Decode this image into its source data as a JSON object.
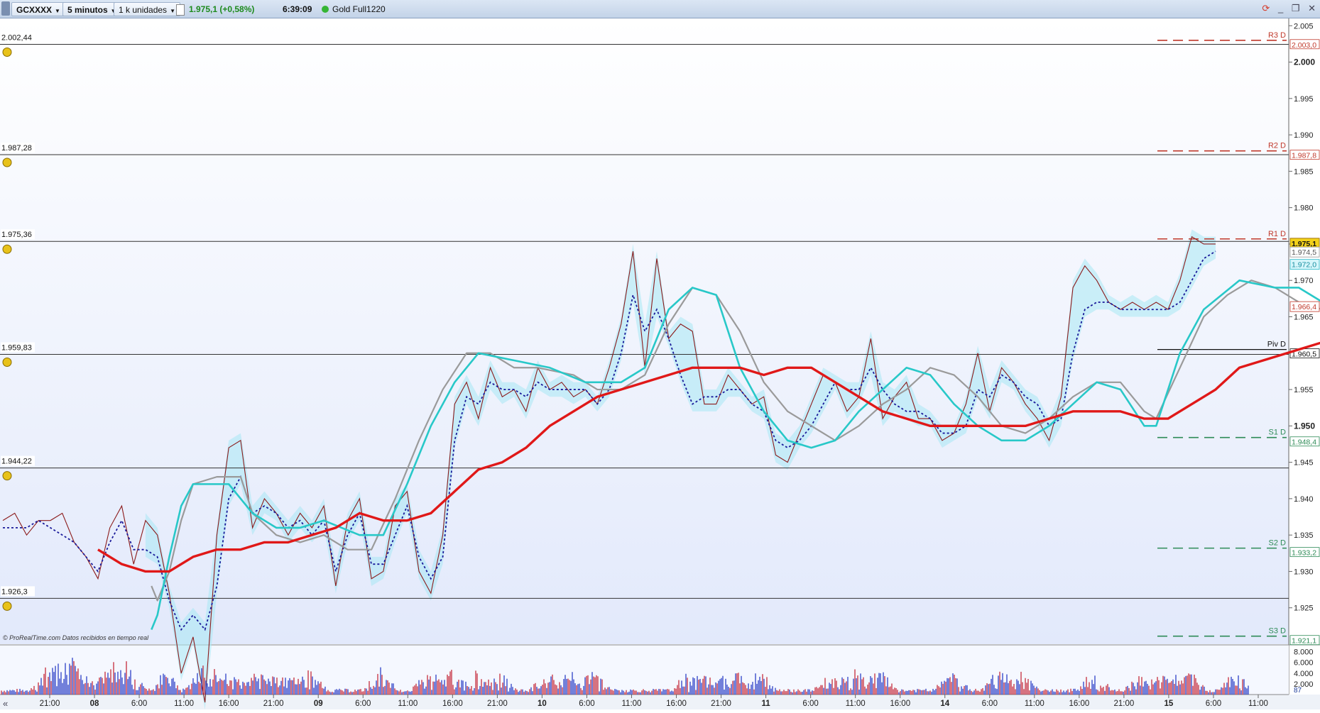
{
  "toolbar": {
    "symbol": "GCXXXX",
    "timeframe": "5 minutos",
    "units": "1 k unidades",
    "price_change": "1.975,1 (+0,58%)",
    "time": "6:39:09",
    "instrument": "Gold Full1220"
  },
  "watermark": "© ProRealTime.com  Datos recibidos en tiempo real",
  "colors": {
    "price_line": "#8b1a1a",
    "ma_red": "#e01818",
    "ma_cyan": "#28c8c8",
    "ma_gray": "#9a9a9a",
    "ma_dotted": "#1a1a9a",
    "resistance": "#c0392b",
    "support": "#2e8b57",
    "cloud": "#a8e8f4"
  },
  "chart_data": {
    "type": "line",
    "title": "",
    "y_range": [
      1920,
      2006
    ],
    "y_ticks": [
      "2.005",
      "2.000",
      "1.995",
      "1.990",
      "1.985",
      "1.980",
      "1.975",
      "1.970",
      "1.965",
      "1.955",
      "1.950",
      "1.945",
      "1.940",
      "1.935",
      "1.930",
      "1.925"
    ],
    "x_ticks": [
      "21:00",
      "08",
      "6:00",
      "11:00",
      "16:00",
      "21:00",
      "09",
      "6:00",
      "11:00",
      "16:00",
      "21:00",
      "10",
      "6:00",
      "11:00",
      "16:00",
      "21:00",
      "11",
      "6:00",
      "11:00",
      "16:00",
      "14",
      "6:00",
      "11:00",
      "16:00",
      "21:00",
      "15",
      "6:00",
      "11:00"
    ],
    "horizontal_levels": [
      {
        "label": "2.002,44",
        "value": 2002.44
      },
      {
        "label": "1.987,28",
        "value": 1987.28
      },
      {
        "label": "1.975,36",
        "value": 1975.36
      },
      {
        "label": "1.959,83",
        "value": 1959.83
      },
      {
        "label": "1.944,22",
        "value": 1944.22
      },
      {
        "label": "1.926,3",
        "value": 1926.3
      }
    ],
    "pivot_levels": [
      {
        "name": "R3 D",
        "value": 2003.0,
        "tag": "2.003,0",
        "kind": "r"
      },
      {
        "name": "R2 D",
        "value": 1987.8,
        "tag": "1.987,8",
        "kind": "r"
      },
      {
        "name": "R1 D",
        "value": 1975.7,
        "tag": "1.975,7",
        "kind": "r"
      },
      {
        "name": "Piv D",
        "value": 1960.5,
        "tag": "1.960,5",
        "kind": "p"
      },
      {
        "name": "S1 D",
        "value": 1948.4,
        "tag": "1.948,4",
        "kind": "s"
      },
      {
        "name": "S2 D",
        "value": 1933.2,
        "tag": "1.933,2",
        "kind": "s"
      },
      {
        "name": "S3 D",
        "value": 1921.1,
        "tag": "1.921,1",
        "kind": "s"
      }
    ],
    "right_tags": [
      {
        "text": "1.975,1",
        "value": 1975.1,
        "kind": "current"
      },
      {
        "text": "1.974,5",
        "value": 1973.9,
        "kind": "plain"
      },
      {
        "text": "1.972,0",
        "value": 1972.2,
        "kind": "cyan"
      },
      {
        "text": "1.966,4",
        "value": 1966.4,
        "kind": "red"
      }
    ],
    "series": [
      {
        "name": "price",
        "values": [
          1937,
          1938,
          1935,
          1937,
          1937,
          1938,
          1934,
          1932,
          1929,
          1936,
          1939,
          1931,
          1937,
          1935,
          1927,
          1916,
          1921,
          1912,
          1935,
          1947,
          1948,
          1936,
          1940,
          1938,
          1935,
          1938,
          1936,
          1939,
          1928,
          1937,
          1940,
          1929,
          1930,
          1939,
          1941,
          1930,
          1927,
          1935,
          1953,
          1956,
          1951,
          1958,
          1954,
          1955,
          1952,
          1958,
          1955,
          1956,
          1954,
          1955,
          1953,
          1958,
          1964,
          1974,
          1958,
          1973,
          1962,
          1964,
          1963,
          1953,
          1953,
          1957,
          1955,
          1953,
          1954,
          1946,
          1945,
          1949,
          1953,
          1957,
          1956,
          1952,
          1954,
          1962,
          1951,
          1954,
          1956,
          1951,
          1951,
          1948,
          1949,
          1953,
          1960,
          1952,
          1958,
          1956,
          1953,
          1951,
          1948,
          1954,
          1969,
          1972,
          1970,
          1967,
          1966,
          1967,
          1966,
          1967,
          1966,
          1970,
          1976,
          1975,
          1975
        ]
      },
      {
        "name": "ma_dotted",
        "values": [
          1936,
          1936,
          1936,
          1937,
          1936,
          1935,
          1934,
          1932,
          1930,
          1934,
          1937,
          1933,
          1933,
          1932,
          1926,
          1922,
          1924,
          1922,
          1928,
          1940,
          1943,
          1938,
          1939,
          1938,
          1936,
          1937,
          1935,
          1937,
          1930,
          1935,
          1938,
          1931,
          1931,
          1935,
          1939,
          1932,
          1929,
          1932,
          1948,
          1954,
          1953,
          1956,
          1955,
          1955,
          1954,
          1956,
          1955,
          1955,
          1955,
          1955,
          1953,
          1955,
          1960,
          1968,
          1963,
          1966,
          1962,
          1957,
          1953,
          1954,
          1954,
          1955,
          1955,
          1953,
          1952,
          1948,
          1947,
          1948,
          1950,
          1953,
          1956,
          1955,
          1955,
          1958,
          1955,
          1953,
          1952,
          1952,
          1951,
          1949,
          1949,
          1950,
          1955,
          1954,
          1957,
          1956,
          1954,
          1953,
          1950,
          1951,
          1960,
          1966,
          1967,
          1967,
          1966,
          1966,
          1966,
          1966,
          1966,
          1967,
          1970,
          1973,
          1974
        ]
      },
      {
        "name": "ma_cyan",
        "points": [
          [
            12.5,
            1922
          ],
          [
            13,
            1924
          ],
          [
            14,
            1932
          ],
          [
            15,
            1939
          ],
          [
            16,
            1942
          ],
          [
            19,
            1942
          ],
          [
            21,
            1938
          ],
          [
            23,
            1936
          ],
          [
            25,
            1936
          ],
          [
            27,
            1937
          ],
          [
            30,
            1935
          ],
          [
            32,
            1935
          ],
          [
            34,
            1942
          ],
          [
            36,
            1950
          ],
          [
            38,
            1956
          ],
          [
            40,
            1960
          ],
          [
            43,
            1959
          ],
          [
            46,
            1958
          ],
          [
            49,
            1956
          ],
          [
            52,
            1956
          ],
          [
            54,
            1958
          ],
          [
            56,
            1966
          ],
          [
            58,
            1969
          ],
          [
            60,
            1968
          ],
          [
            62,
            1958
          ],
          [
            64,
            1952
          ],
          [
            66,
            1948
          ],
          [
            68,
            1947
          ],
          [
            70,
            1948
          ],
          [
            72,
            1952
          ],
          [
            74,
            1955
          ],
          [
            76,
            1958
          ],
          [
            78,
            1957
          ],
          [
            80,
            1953
          ],
          [
            82,
            1950
          ],
          [
            84,
            1948
          ],
          [
            86,
            1948
          ],
          [
            88,
            1950
          ],
          [
            90,
            1953
          ],
          [
            92,
            1956
          ],
          [
            94,
            1955
          ],
          [
            96,
            1950
          ],
          [
            97,
            1950
          ],
          [
            99,
            1960
          ],
          [
            101,
            1966
          ],
          [
            104,
            1970
          ],
          [
            107,
            1969
          ],
          [
            109,
            1969
          ],
          [
            111,
            1967
          ],
          [
            113,
            1969
          ],
          [
            116,
            1972
          ]
        ]
      },
      {
        "name": "ma_gray",
        "points": [
          [
            12.5,
            1928
          ],
          [
            13,
            1926
          ],
          [
            14,
            1930
          ],
          [
            15,
            1937
          ],
          [
            16,
            1942
          ],
          [
            18,
            1943
          ],
          [
            20,
            1943
          ],
          [
            21,
            1938
          ],
          [
            23,
            1935
          ],
          [
            25,
            1934
          ],
          [
            27,
            1935
          ],
          [
            29,
            1933
          ],
          [
            31,
            1933
          ],
          [
            33,
            1940
          ],
          [
            35,
            1948
          ],
          [
            37,
            1955
          ],
          [
            39,
            1960
          ],
          [
            41,
            1960
          ],
          [
            43,
            1958
          ],
          [
            45,
            1958
          ],
          [
            48,
            1957
          ],
          [
            50,
            1955
          ],
          [
            52,
            1955
          ],
          [
            54,
            1957
          ],
          [
            56,
            1964
          ],
          [
            58,
            1969
          ],
          [
            60,
            1968
          ],
          [
            62,
            1963
          ],
          [
            64,
            1956
          ],
          [
            66,
            1952
          ],
          [
            68,
            1950
          ],
          [
            70,
            1948
          ],
          [
            72,
            1950
          ],
          [
            74,
            1953
          ],
          [
            76,
            1955
          ],
          [
            78,
            1958
          ],
          [
            80,
            1957
          ],
          [
            82,
            1954
          ],
          [
            84,
            1950
          ],
          [
            86,
            1949
          ],
          [
            88,
            1951
          ],
          [
            90,
            1954
          ],
          [
            92,
            1956
          ],
          [
            94,
            1956
          ],
          [
            96,
            1952
          ],
          [
            97,
            1951
          ],
          [
            99,
            1958
          ],
          [
            101,
            1965
          ],
          [
            103,
            1968
          ],
          [
            105,
            1970
          ],
          [
            107,
            1969
          ],
          [
            109,
            1967
          ],
          [
            111,
            1966
          ],
          [
            113,
            1966
          ],
          [
            115,
            1966
          ]
        ]
      },
      {
        "name": "ma_red",
        "points": [
          [
            8,
            1933
          ],
          [
            10,
            1931
          ],
          [
            12,
            1930
          ],
          [
            14,
            1930
          ],
          [
            16,
            1932
          ],
          [
            18,
            1933
          ],
          [
            20,
            1933
          ],
          [
            22,
            1934
          ],
          [
            24,
            1934
          ],
          [
            26,
            1935
          ],
          [
            28,
            1936
          ],
          [
            30,
            1938
          ],
          [
            32,
            1937
          ],
          [
            34,
            1937
          ],
          [
            36,
            1938
          ],
          [
            38,
            1941
          ],
          [
            40,
            1944
          ],
          [
            42,
            1945
          ],
          [
            44,
            1947
          ],
          [
            46,
            1950
          ],
          [
            48,
            1952
          ],
          [
            50,
            1954
          ],
          [
            52,
            1955
          ],
          [
            54,
            1956
          ],
          [
            56,
            1957
          ],
          [
            58,
            1958
          ],
          [
            60,
            1958
          ],
          [
            62,
            1958
          ],
          [
            64,
            1957
          ],
          [
            66,
            1958
          ],
          [
            68,
            1958
          ],
          [
            70,
            1956
          ],
          [
            72,
            1954
          ],
          [
            74,
            1952
          ],
          [
            76,
            1951
          ],
          [
            78,
            1950
          ],
          [
            80,
            1950
          ],
          [
            82,
            1950
          ],
          [
            84,
            1950
          ],
          [
            86,
            1950
          ],
          [
            88,
            1951
          ],
          [
            90,
            1952
          ],
          [
            92,
            1952
          ],
          [
            94,
            1952
          ],
          [
            96,
            1951
          ],
          [
            98,
            1951
          ],
          [
            100,
            1953
          ],
          [
            102,
            1955
          ],
          [
            104,
            1958
          ],
          [
            106,
            1959
          ],
          [
            108,
            1960
          ],
          [
            110,
            1961
          ],
          [
            112,
            1962
          ],
          [
            114,
            1964
          ],
          [
            116,
            1966
          ]
        ]
      }
    ],
    "volume": {
      "y_ticks": [
        "8.000",
        "6.000",
        "4.000",
        "2.000"
      ],
      "last_label": "87",
      "bursts": [
        4,
        5,
        6,
        7,
        9,
        10,
        11,
        14,
        17,
        18,
        20,
        22,
        24,
        26,
        32,
        36,
        38,
        40,
        42,
        46,
        48,
        50,
        58,
        60,
        62,
        64,
        70,
        72,
        74,
        80,
        84,
        86,
        92,
        96,
        98,
        100,
        104,
        108,
        110
      ]
    }
  }
}
